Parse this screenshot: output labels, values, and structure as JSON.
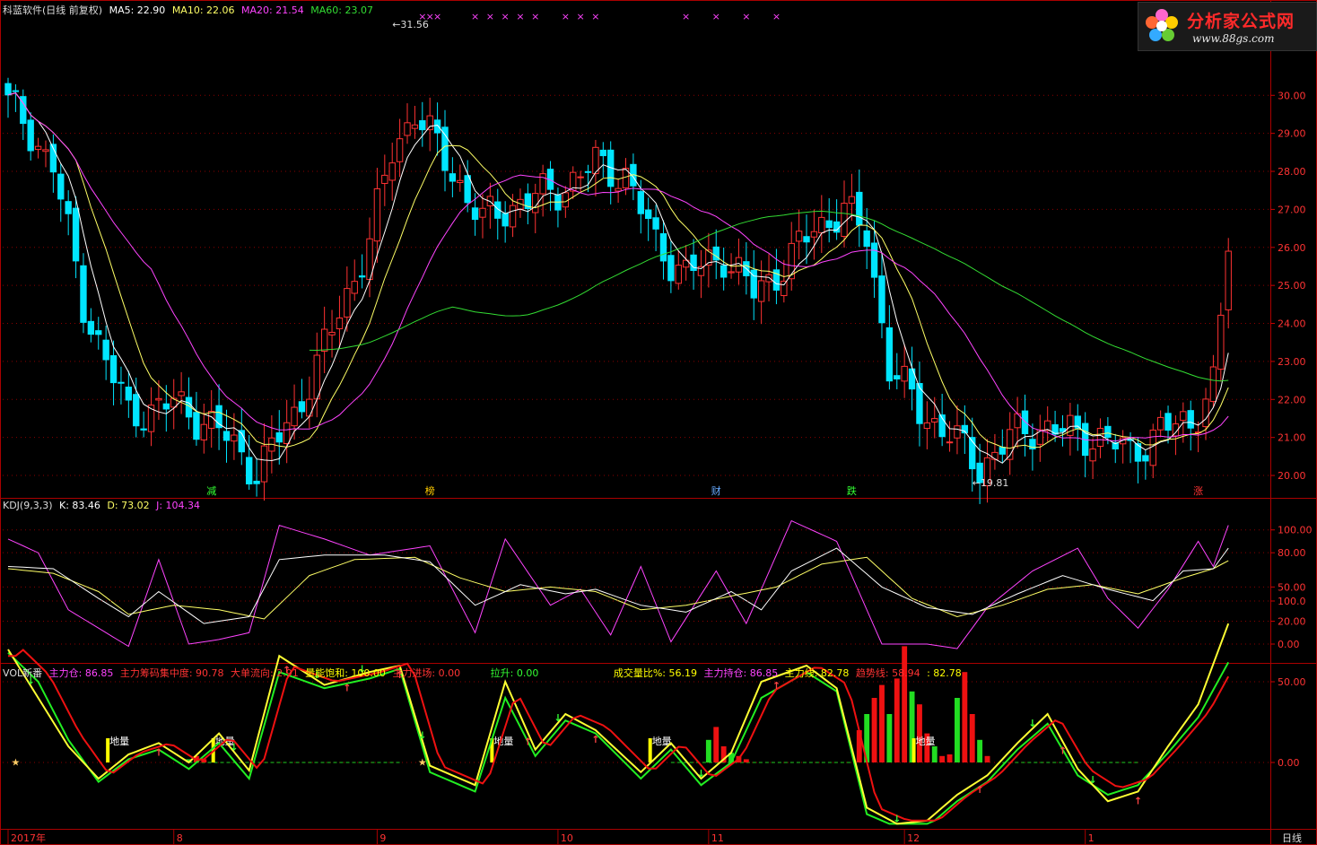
{
  "main_header": {
    "title": "科蓝软件(日线 前复权)",
    "ma5": "MA5: 22.90",
    "ma10": "MA10: 22.06",
    "ma20": "MA20: 21.54",
    "ma60": "MA60: 23.07"
  },
  "kdj_header": {
    "title": "KDJ(9,3,3)",
    "k": "K: 83.46",
    "d": "D: 73.02",
    "j": "J: 104.34"
  },
  "vol_header": {
    "title": "VOL新番",
    "items": [
      {
        "label": "主力仓: 86.85",
        "color": "#ff44ff"
      },
      {
        "label": "主力筹码集中度: 90.78",
        "color": "#ff3333"
      },
      {
        "label": "大单流向: 2.91",
        "color": "#ff3333"
      },
      {
        "label": "量能饱和: 100.00",
        "color": "#ffff00"
      },
      {
        "label": "主力进场: 0.00",
        "color": "#ff3333"
      },
      {
        "label": "拉升: 0.00",
        "color": "#33ff33"
      },
      {
        "label": "成交量比%: 56.19",
        "color": "#ffff00"
      },
      {
        "label": "主力持仓: 86.85",
        "color": "#ff44ff"
      },
      {
        "label": "主力线: 82.78",
        "color": "#ffff00"
      },
      {
        "label": "趋势线: 58.94",
        "color": "#ff3333"
      },
      {
        "label": ": 82.78",
        "color": "#ffff00"
      }
    ]
  },
  "logo": {
    "name": "分析家公式网",
    "url": "www.88gs.com"
  },
  "price_axis": [
    "30.00",
    "29.00",
    "28.00",
    "27.00",
    "26.00",
    "25.00",
    "24.00",
    "23.00",
    "22.00",
    "21.00",
    "20.00"
  ],
  "kdj_axis": [
    "100.00",
    "80.00",
    "50.00",
    "20.00",
    "0.00"
  ],
  "vol_axis": [
    "100.0",
    "50.00",
    "0.00"
  ],
  "date_axis": [
    {
      "label": "2017年"
    },
    {
      "label": "8"
    },
    {
      "label": "9"
    },
    {
      "label": "10"
    },
    {
      "label": "11"
    },
    {
      "label": "12"
    },
    {
      "label": "1"
    }
  ],
  "period_label": "日线",
  "high_label": "31.56",
  "low_label": "19.81",
  "event_tags": [
    {
      "text": "减",
      "color": "#33ff33"
    },
    {
      "text": "榜",
      "color": "#ffcc00"
    },
    {
      "text": "财",
      "color": "#66aaff"
    },
    {
      "text": "跌",
      "color": "#33ff33"
    },
    {
      "text": "涨",
      "color": "#ff3333"
    }
  ],
  "diliang_label": "地量",
  "colors": {
    "up": "#ff3232",
    "down": "#00e5ff",
    "ma5": "#ffffff",
    "ma10": "#ffff66",
    "ma20": "#ff44ff",
    "ma60": "#33dd33",
    "grid": "#8b0000"
  },
  "chart_data": {
    "type": "candlestick",
    "title": "科蓝软件(日线 前复权)",
    "ylim": [
      19.6,
      31.8
    ],
    "period_high": 31.56,
    "period_low": 19.81,
    "anchors": [
      [
        0,
        29.8
      ],
      [
        6,
        28.2
      ],
      [
        10,
        24.5
      ],
      [
        16,
        21.6
      ],
      [
        22,
        21.9
      ],
      [
        28,
        21.2
      ],
      [
        33,
        20.1
      ],
      [
        38,
        21.6
      ],
      [
        43,
        23.8
      ],
      [
        48,
        26.2
      ],
      [
        51,
        28.5
      ],
      [
        54,
        29.6
      ],
      [
        58,
        28.3
      ],
      [
        63,
        26.7
      ],
      [
        68,
        27.2
      ],
      [
        73,
        27.5
      ],
      [
        78,
        28.2
      ],
      [
        82,
        27.9
      ],
      [
        86,
        26.1
      ],
      [
        90,
        25.3
      ],
      [
        95,
        25.8
      ],
      [
        99,
        24.8
      ],
      [
        103,
        25.5
      ],
      [
        107,
        26.5
      ],
      [
        111,
        27.0
      ],
      [
        114,
        26.3
      ],
      [
        117,
        22.9
      ],
      [
        121,
        21.7
      ],
      [
        125,
        21.1
      ],
      [
        129,
        20.2
      ],
      [
        133,
        21.0
      ],
      [
        137,
        21.3
      ],
      [
        141,
        21.1
      ],
      [
        145,
        21.0
      ],
      [
        149,
        20.6
      ],
      [
        153,
        21.2
      ],
      [
        157,
        21.4
      ],
      [
        160,
        22.4
      ],
      [
        162,
        25.8
      ]
    ],
    "kdj_k": [
      [
        0,
        68
      ],
      [
        6,
        66
      ],
      [
        12,
        40
      ],
      [
        16,
        24
      ],
      [
        20,
        46
      ],
      [
        26,
        18
      ],
      [
        32,
        24
      ],
      [
        36,
        74
      ],
      [
        42,
        78
      ],
      [
        50,
        78
      ],
      [
        56,
        72
      ],
      [
        62,
        34
      ],
      [
        68,
        52
      ],
      [
        74,
        44
      ],
      [
        78,
        48
      ],
      [
        84,
        34
      ],
      [
        90,
        28
      ],
      [
        96,
        46
      ],
      [
        100,
        30
      ],
      [
        104,
        64
      ],
      [
        110,
        84
      ],
      [
        116,
        50
      ],
      [
        122,
        32
      ],
      [
        128,
        26
      ],
      [
        134,
        44
      ],
      [
        140,
        60
      ],
      [
        146,
        48
      ],
      [
        152,
        38
      ],
      [
        156,
        64
      ],
      [
        160,
        66
      ],
      [
        162,
        84
      ]
    ],
    "kdj_d": [
      [
        0,
        66
      ],
      [
        6,
        62
      ],
      [
        12,
        46
      ],
      [
        16,
        26
      ],
      [
        22,
        34
      ],
      [
        28,
        30
      ],
      [
        34,
        22
      ],
      [
        40,
        60
      ],
      [
        46,
        74
      ],
      [
        54,
        76
      ],
      [
        60,
        58
      ],
      [
        66,
        46
      ],
      [
        72,
        50
      ],
      [
        78,
        46
      ],
      [
        84,
        30
      ],
      [
        90,
        34
      ],
      [
        96,
        42
      ],
      [
        102,
        50
      ],
      [
        108,
        70
      ],
      [
        114,
        76
      ],
      [
        120,
        40
      ],
      [
        126,
        24
      ],
      [
        132,
        34
      ],
      [
        138,
        48
      ],
      [
        144,
        52
      ],
      [
        150,
        44
      ],
      [
        156,
        58
      ],
      [
        160,
        66
      ],
      [
        162,
        73
      ]
    ],
    "kdj_j": [
      [
        0,
        92
      ],
      [
        4,
        80
      ],
      [
        8,
        30
      ],
      [
        12,
        14
      ],
      [
        16,
        -2
      ],
      [
        20,
        74
      ],
      [
        24,
        0
      ],
      [
        28,
        4
      ],
      [
        32,
        10
      ],
      [
        36,
        104
      ],
      [
        42,
        92
      ],
      [
        48,
        78
      ],
      [
        56,
        86
      ],
      [
        62,
        10
      ],
      [
        66,
        92
      ],
      [
        72,
        34
      ],
      [
        76,
        48
      ],
      [
        80,
        8
      ],
      [
        84,
        68
      ],
      [
        88,
        2
      ],
      [
        94,
        64
      ],
      [
        98,
        18
      ],
      [
        104,
        108
      ],
      [
        110,
        90
      ],
      [
        116,
        0
      ],
      [
        122,
        0
      ],
      [
        126,
        -4
      ],
      [
        130,
        32
      ],
      [
        136,
        64
      ],
      [
        142,
        84
      ],
      [
        146,
        40
      ],
      [
        150,
        14
      ],
      [
        154,
        48
      ],
      [
        158,
        90
      ],
      [
        160,
        68
      ],
      [
        162,
        104
      ]
    ],
    "vol_main": [
      [
        0,
        70
      ],
      [
        4,
        40
      ],
      [
        8,
        10
      ],
      [
        12,
        -10
      ],
      [
        16,
        5
      ],
      [
        20,
        12
      ],
      [
        24,
        0
      ],
      [
        28,
        18
      ],
      [
        32,
        -5
      ],
      [
        36,
        66
      ],
      [
        42,
        48
      ],
      [
        48,
        56
      ],
      [
        52,
        60
      ],
      [
        56,
        -2
      ],
      [
        62,
        -14
      ],
      [
        66,
        50
      ],
      [
        70,
        8
      ],
      [
        74,
        30
      ],
      [
        78,
        20
      ],
      [
        84,
        -6
      ],
      [
        88,
        12
      ],
      [
        92,
        -10
      ],
      [
        96,
        6
      ],
      [
        100,
        50
      ],
      [
        106,
        60
      ],
      [
        110,
        46
      ],
      [
        114,
        -28
      ],
      [
        118,
        -38
      ],
      [
        122,
        -36
      ],
      [
        126,
        -20
      ],
      [
        130,
        -8
      ],
      [
        134,
        12
      ],
      [
        138,
        30
      ],
      [
        142,
        -4
      ],
      [
        146,
        -24
      ],
      [
        150,
        -18
      ],
      [
        154,
        10
      ],
      [
        158,
        36
      ],
      [
        162,
        86
      ]
    ],
    "vol_trend": [
      [
        0,
        68
      ],
      [
        4,
        50
      ],
      [
        8,
        14
      ],
      [
        12,
        -12
      ],
      [
        16,
        2
      ],
      [
        20,
        8
      ],
      [
        24,
        -4
      ],
      [
        28,
        12
      ],
      [
        32,
        -10
      ],
      [
        36,
        56
      ],
      [
        42,
        46
      ],
      [
        48,
        52
      ],
      [
        52,
        58
      ],
      [
        56,
        -6
      ],
      [
        62,
        -18
      ],
      [
        66,
        40
      ],
      [
        70,
        4
      ],
      [
        74,
        26
      ],
      [
        78,
        18
      ],
      [
        84,
        -10
      ],
      [
        88,
        8
      ],
      [
        92,
        -14
      ],
      [
        96,
        0
      ],
      [
        100,
        40
      ],
      [
        106,
        56
      ],
      [
        110,
        44
      ],
      [
        114,
        -32
      ],
      [
        118,
        -40
      ],
      [
        122,
        -40
      ],
      [
        126,
        -24
      ],
      [
        130,
        -12
      ],
      [
        134,
        8
      ],
      [
        138,
        24
      ],
      [
        142,
        -8
      ],
      [
        146,
        -20
      ],
      [
        150,
        -14
      ],
      [
        154,
        6
      ],
      [
        158,
        28
      ],
      [
        162,
        62
      ]
    ],
    "vol_bars": [
      [
        113,
        20
      ],
      [
        114,
        30
      ],
      [
        115,
        40
      ],
      [
        116,
        48
      ],
      [
        117,
        30
      ],
      [
        118,
        52
      ],
      [
        119,
        72
      ],
      [
        120,
        44
      ],
      [
        121,
        36
      ],
      [
        122,
        18
      ],
      [
        123,
        10
      ],
      [
        124,
        4
      ],
      [
        125,
        5
      ],
      [
        126,
        40
      ],
      [
        127,
        56
      ],
      [
        128,
        30
      ],
      [
        129,
        14
      ],
      [
        130,
        4
      ]
    ],
    "vol_bars_small": [
      [
        93,
        14
      ],
      [
        94,
        22
      ],
      [
        95,
        10
      ],
      [
        96,
        6
      ],
      [
        97,
        4
      ],
      [
        98,
        2
      ],
      [
        24,
        2
      ],
      [
        25,
        4
      ],
      [
        26,
        2
      ]
    ]
  }
}
